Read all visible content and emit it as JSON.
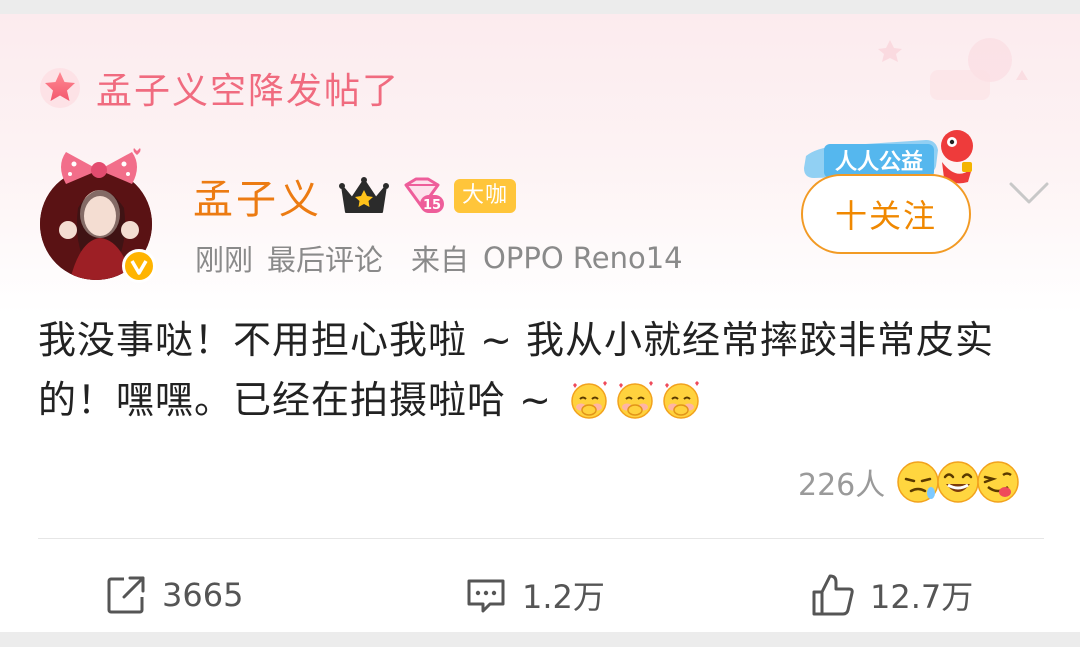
{
  "banner": {
    "icon": "star-icon",
    "text": "孟子义空降发帖了"
  },
  "author": {
    "name": "孟子义",
    "avatar": "avatar",
    "crown_icon": "crown-icon",
    "vip_icon": "diamond-level-icon",
    "vip_level": "15",
    "badge": "大咖",
    "time": "刚刚",
    "activity": "最后评论",
    "source_prefix": "来自",
    "device": "OPPO Reno14"
  },
  "follow": {
    "label": "十关注",
    "charity_badge": "人人公益"
  },
  "post": {
    "text": "我没事哒！不用担心我啦 ~ 我从小就经常摔跤非常皮实的！嘿嘿。已经在拍摄啦哈 ~",
    "emojis": [
      "emoji-hug",
      "emoji-hug",
      "emoji-hug"
    ]
  },
  "reactions": {
    "count": "226人",
    "icons": [
      "emoji-sleepy",
      "emoji-laugh",
      "emoji-lick"
    ]
  },
  "actions": {
    "share": {
      "icon": "share-icon",
      "count": "3665"
    },
    "comment": {
      "icon": "comment-icon",
      "count": "1.2万"
    },
    "like": {
      "icon": "thumbs-up-icon",
      "count": "12.7万"
    }
  },
  "colors": {
    "accent": "#f08800",
    "name": "#ec7b12",
    "banner_text": "#f06b7f",
    "meta": "#8a8a8a",
    "body": "#222222",
    "badge_bg": "#ffc53a"
  }
}
